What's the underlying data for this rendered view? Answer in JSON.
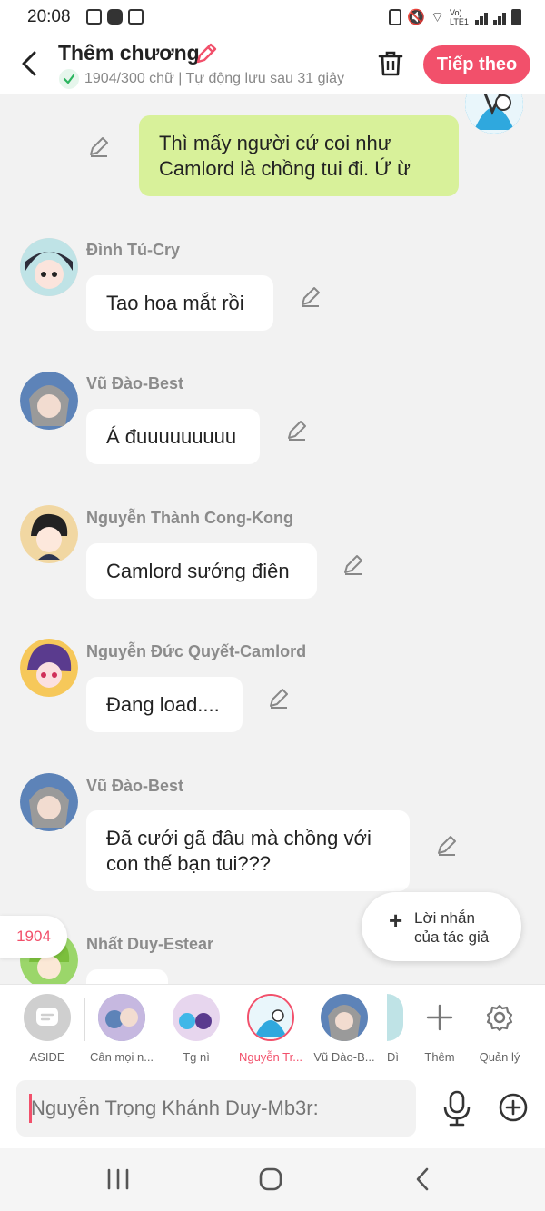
{
  "status_bar": {
    "time": "20:08",
    "network_label": "Vo) LTE1"
  },
  "header": {
    "title": "Thêm chương",
    "subtitle": "1904/300 chữ | Tự động lưu sau 31 giây",
    "next_label": "Tiếp theo"
  },
  "messages": [
    {
      "sender": "",
      "text": "Thì mấy người cứ coi như Camlord là chồng tui đi. Ứ ừ",
      "mine": true
    },
    {
      "sender": "Đình Tú-Cry",
      "text": "Tao hoa mắt rồi"
    },
    {
      "sender": "Vũ Đào-Best",
      "text": "Á đuuuuuuuuu"
    },
    {
      "sender": "Nguyễn Thành Cong-Kong",
      "text": "Camlord sướng điên"
    },
    {
      "sender": "Nguyễn Đức Quyết-Camlord",
      "text": "Đang load...."
    },
    {
      "sender": "Vũ Đào-Best",
      "text": "Đã cưới gã đâu mà chồng với con thế bạn tui???"
    },
    {
      "sender": "Nhất Duy-Estear",
      "text": ""
    }
  ],
  "author_note": {
    "line1": "Lời nhắn",
    "line2": "của tác giả"
  },
  "word_count_badge": "1904",
  "characters": [
    {
      "label": "ASIDE"
    },
    {
      "label": "Cân mọi n..."
    },
    {
      "label": "Tg nì"
    },
    {
      "label": "Nguyễn Tr..."
    },
    {
      "label": "Vũ Đào-B..."
    },
    {
      "label": "Đì"
    }
  ],
  "char_actions": {
    "add_label": "Thêm",
    "manage_label": "Quản lý"
  },
  "input": {
    "placeholder": "Nguyễn Trọng Khánh Duy-Mb3r:"
  },
  "colors": {
    "accent": "#f2506b",
    "mine_bubble": "#d8f19a"
  }
}
